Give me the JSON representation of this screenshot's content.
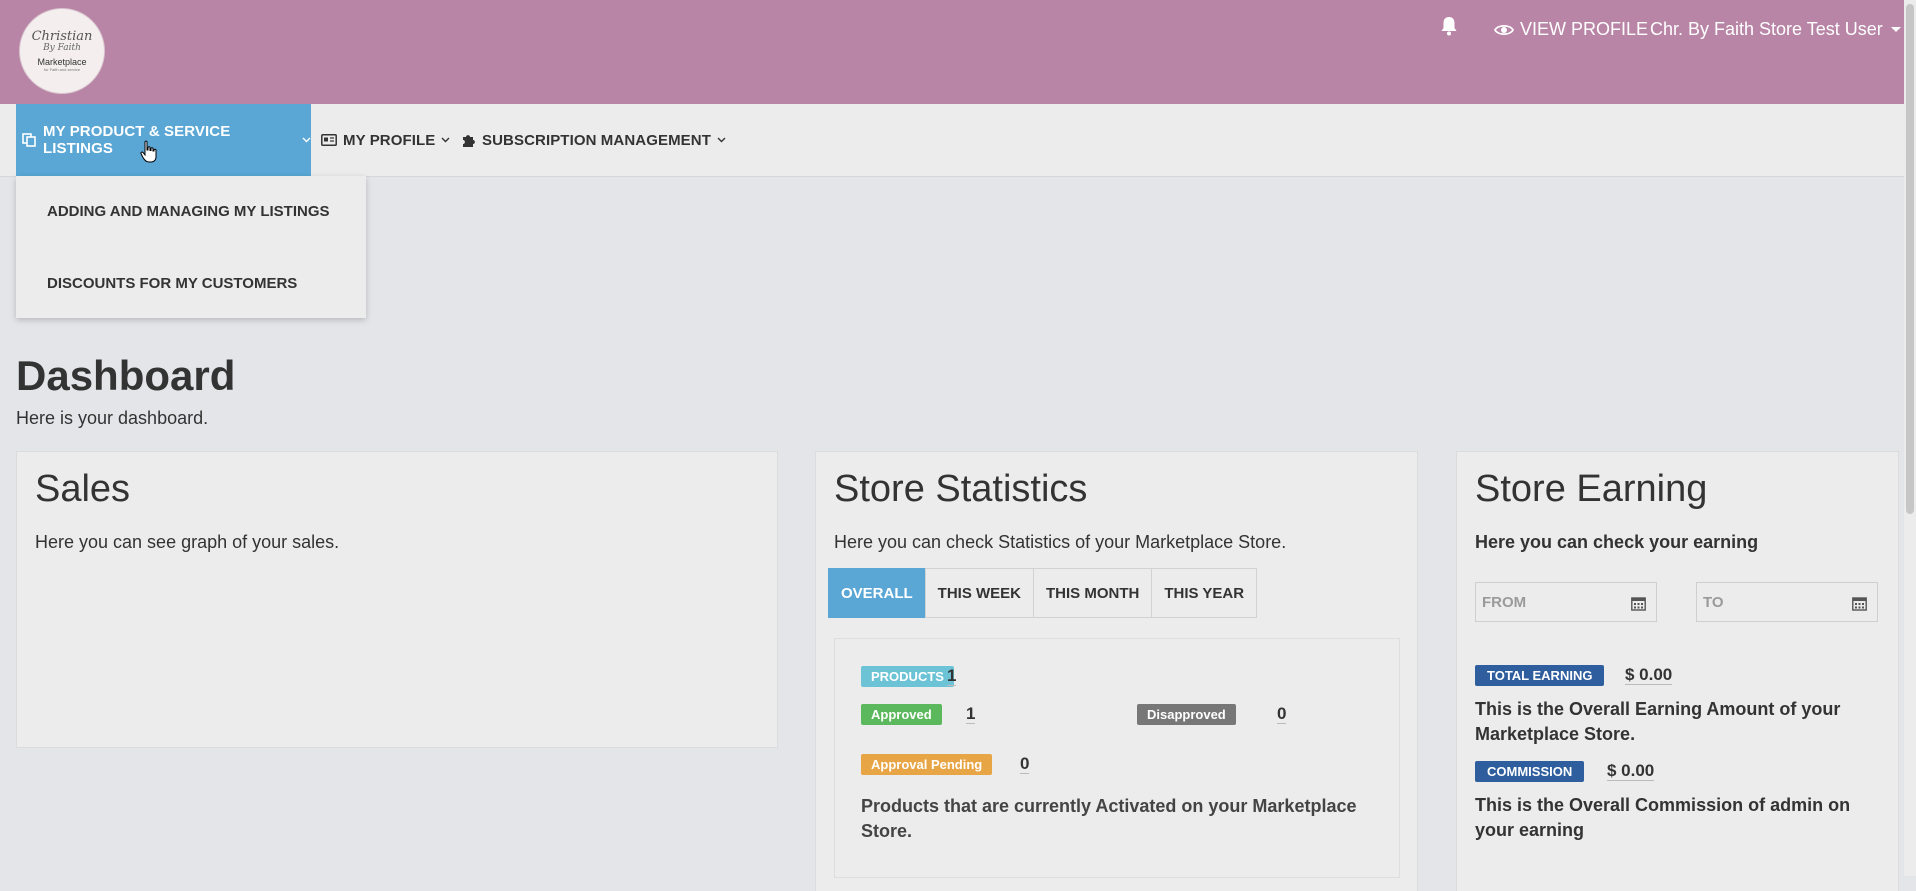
{
  "header": {
    "logo": {
      "line1": "Christian",
      "line2": "By Faith",
      "line3": "Marketplace",
      "line4": "for Faith and service"
    },
    "view_profile": "VIEW PROFILE",
    "user_name": "Chr. By Faith Store Test User"
  },
  "nav": {
    "items": [
      {
        "label": "MY PRODUCT & SERVICE LISTINGS",
        "icon": "copy-icon"
      },
      {
        "label": "MY PROFILE",
        "icon": "id-card-icon"
      },
      {
        "label": "SUBSCRIPTION MANAGEMENT",
        "icon": "puzzle-icon"
      }
    ],
    "dropdown": [
      "ADDING AND MANAGING MY LISTINGS",
      "DISCOUNTS FOR MY CUSTOMERS"
    ]
  },
  "page": {
    "title": "Dashboard",
    "subtitle": "Here is your dashboard."
  },
  "sales": {
    "title": "Sales",
    "desc": "Here you can see graph of your sales."
  },
  "stats": {
    "title": "Store Statistics",
    "desc": "Here you can check Statistics of your Marketplace Store.",
    "tabs": [
      "OVERALL",
      "THIS WEEK",
      "THIS MONTH",
      "THIS YEAR"
    ],
    "products_label": "PRODUCTS",
    "products_value": "1",
    "approved_label": "Approved",
    "approved_value": "1",
    "disapproved_label": "Disapproved",
    "disapproved_value": "0",
    "pending_label": "Approval Pending",
    "pending_value": "0",
    "note": "Products that are currently Activated on your Marketplace Store."
  },
  "earning": {
    "title": "Store Earning",
    "desc": "Here you can check your earning",
    "from_placeholder": "FROM",
    "to_placeholder": "TO",
    "total_label": "TOTAL EARNING",
    "total_value": "$ 0.00",
    "total_note": "This is the Overall Earning Amount of your Marketplace Store.",
    "commission_label": "COMMISSION",
    "commission_value": "$ 0.00",
    "commission_note": "This is the Overall Commission of admin on your earning"
  },
  "colors": {
    "header": "#b985a6",
    "active": "#5aa7d6",
    "products": "#6cc3d5",
    "approved": "#5cb85c",
    "disapproved": "#777777",
    "pending": "#e8a546",
    "earning": "#2f5e9e"
  }
}
